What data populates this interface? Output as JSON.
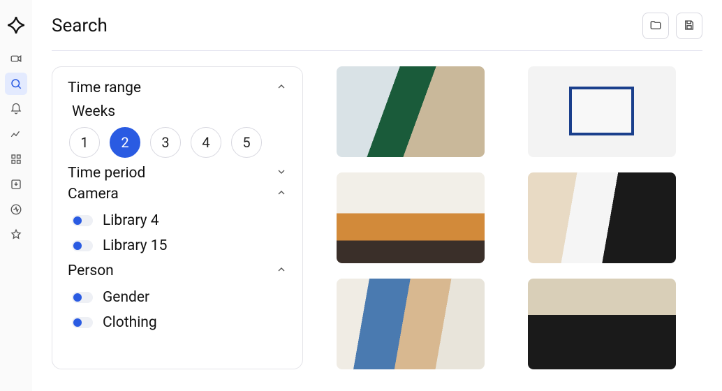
{
  "page_title": "Search",
  "sidebar": {
    "items": [
      "camera",
      "search",
      "bell",
      "analytics",
      "grid",
      "download",
      "activity",
      "star"
    ],
    "active_index": 1
  },
  "header_actions": [
    "folder",
    "save"
  ],
  "filters": {
    "time_range": {
      "label": "Time range",
      "weeks_label": "Weeks",
      "weeks": [
        "1",
        "2",
        "3",
        "4",
        "5"
      ],
      "weeks_active_index": 1,
      "expanded": true
    },
    "time_period": {
      "label": "Time period",
      "expanded": false
    },
    "camera": {
      "label": "Camera",
      "expanded": true,
      "options": [
        {
          "label": "Library 4",
          "on": true
        },
        {
          "label": "Library 15",
          "on": true
        }
      ]
    },
    "person": {
      "label": "Person",
      "expanded": true,
      "options": [
        {
          "label": "Gender",
          "on": true
        },
        {
          "label": "Clothing",
          "on": true
        }
      ]
    }
  },
  "results_count": 6
}
